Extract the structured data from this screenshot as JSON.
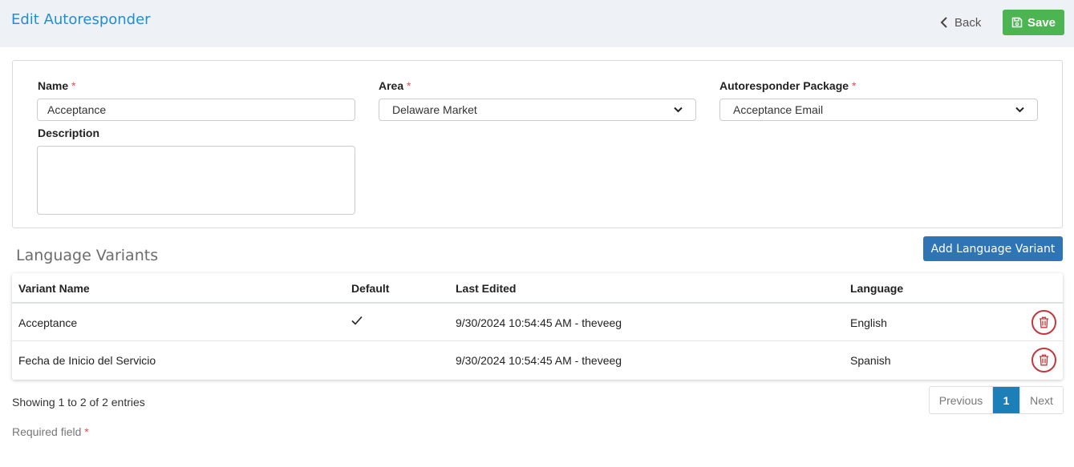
{
  "header": {
    "title": "Edit Autoresponder",
    "back_label": "Back",
    "save_label": "Save"
  },
  "form": {
    "name": {
      "label": "Name",
      "required_mark": "*",
      "value": "Acceptance"
    },
    "area": {
      "label": "Area",
      "required_mark": "*",
      "value": "Delaware Market"
    },
    "package": {
      "label": "Autoresponder Package",
      "required_mark": "*",
      "value": "Acceptance Email"
    },
    "description": {
      "label": "Description",
      "value": ""
    }
  },
  "variants": {
    "title": "Language Variants",
    "add_label": "Add Language Variant",
    "columns": [
      "Variant Name",
      "Default",
      "Last Edited",
      "Language"
    ],
    "rows": [
      {
        "name": "Acceptance",
        "default": true,
        "last_edited": "9/30/2024 10:54:45 AM - theveeg",
        "language": "English"
      },
      {
        "name": "Fecha de Inicio del Servicio",
        "default": false,
        "last_edited": "9/30/2024 10:54:45 AM - theveeg",
        "language": "Spanish"
      }
    ],
    "showing": "Showing 1 to 2 of 2 entries",
    "pagination": {
      "previous": "Previous",
      "current": "1",
      "next": "Next"
    }
  },
  "footer": {
    "required_note": "Required field",
    "required_mark": "*"
  },
  "icons": {
    "back": "chevron-left-icon",
    "save": "floppy-disk-icon",
    "select": "chevron-down-icon",
    "default": "checkmark-icon",
    "delete": "trash-icon"
  },
  "colors": {
    "title": "#1f8fd3",
    "save_button": "#4cb450",
    "add_button": "#2f74b5",
    "delete": "#c0393b",
    "required": "#d9534f",
    "pager_active": "#1c7fb8"
  }
}
